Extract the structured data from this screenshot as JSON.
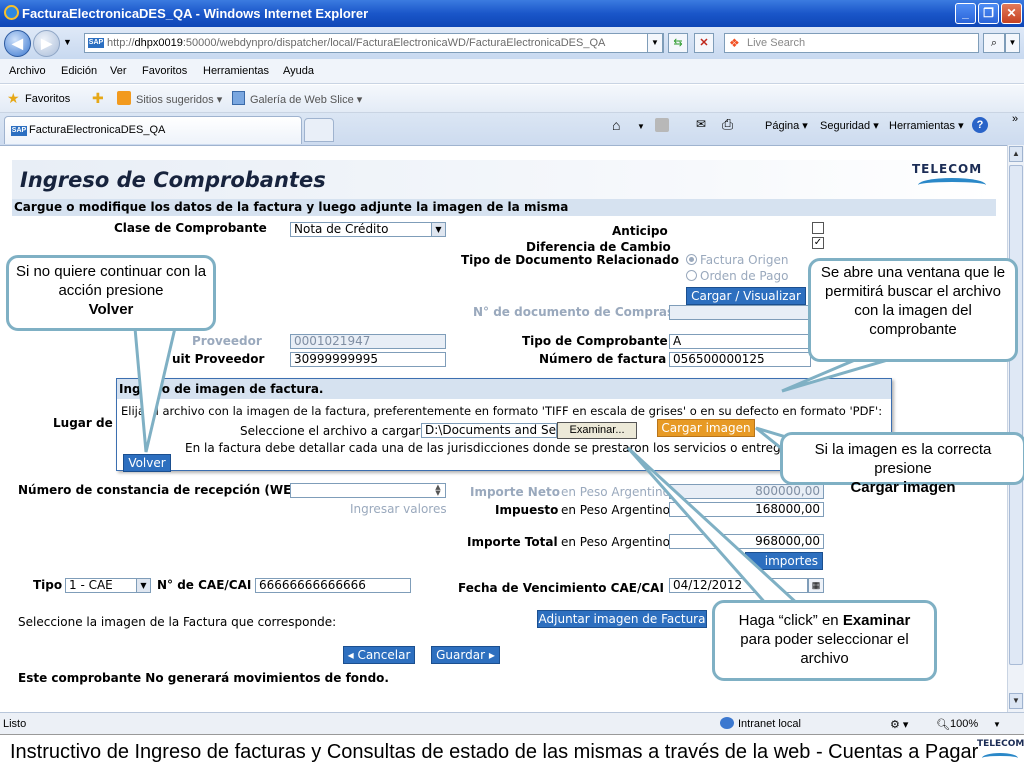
{
  "window": {
    "title": "FacturaElectronicaDES_QA - Windows Internet Explorer"
  },
  "address": {
    "url_prefix": "http://",
    "url_host": "dhpx0019",
    "url_rest": ":50000/webdynpro/dispatcher/local/FacturaElectronicaWD/FacturaElectronicaDES_QA",
    "search_placeholder": "Live Search"
  },
  "menu": [
    "Archivo",
    "Edición",
    "Ver",
    "Favoritos",
    "Herramientas",
    "Ayuda"
  ],
  "favorites": {
    "label": "Favoritos",
    "suggested": "Sitios sugeridos ▾",
    "gallery": "Galería de Web Slice ▾"
  },
  "tab": {
    "label": "FacturaElectronicaDES_QA"
  },
  "commandbar": {
    "page": "Página ▾",
    "security": "Seguridad ▾",
    "tools": "Herramientas ▾"
  },
  "page": {
    "title": "Ingreso de Comprobantes",
    "brand": "TELECOM",
    "subtitle": "Cargue o modifique los datos de la factura y luego adjunte la imagen de la misma",
    "clase_label": "Clase de Comprobante",
    "clase_value": "Nota de Crédito",
    "anticipo_label": "Anticipo",
    "dif_cambio_label": "Diferencia de Cambio",
    "tipo_doc_rel_label": "Tipo de Documento Relacionado",
    "radio_factura": "Factura Origen",
    "radio_orden": "Orden de Pago",
    "cargar_visualizar": "Cargar / Visualizar",
    "nro_doc_compras_label": "N° de documento de Compras",
    "proveedor_label": "Proveedor",
    "proveedor_value": "0001021947",
    "cuit_label": "uit Proveedor",
    "cuit_value": "30999999995",
    "tipo_comp_label": "Tipo de Comprobante",
    "tipo_comp_value": "A",
    "nro_factura_label": "Número de factura",
    "nro_factura_value": "056500000125",
    "lugar_label": "Lugar de",
    "constancia_label": "Número de constancia de recepción (WE)",
    "ingresar_valores": "Ingresar valores",
    "importe_neto_label": "Importe Neto",
    "importe_neto_currency": "en Peso Argentino",
    "importe_neto_value": "800000,00",
    "impuesto_label": "Impuesto",
    "impuesto_currency": "en Peso Argentino",
    "impuesto_value": "168000,00",
    "importe_total_label": "Importe Total",
    "importe_total_currency": "en Peso Argentino",
    "importe_total_value": "968000,00",
    "importes_btn": "importes",
    "tipo_label": "Tipo",
    "tipo_value": "1 - CAE",
    "nro_cae_label": "N° de CAE/CAI",
    "nro_cae_value": "66666666666666",
    "fecha_venc_label": "Fecha de Vencimiento CAE/CAI",
    "fecha_venc_value": "04/12/2012",
    "seleccione_imagen": "Seleccione la imagen de la Factura que corresponde:",
    "adjuntar_btn": "Adjuntar imagen de Factura",
    "cancelar_btn": "Cancelar",
    "guardar_btn": "Guardar",
    "footer_note": "Este comprobante No generará movimientos de fondo."
  },
  "popup": {
    "title": "Ingreso de imagen de factura.",
    "instructions": "Elija el archivo con la imagen de la factura, preferentemente en formato 'TIFF en escala de grises' o en su defecto en formato 'PDF':",
    "file_label": "Seleccione el archivo a cargar:",
    "file_value": "D:\\Documents and Set",
    "examinar": "Examinar...",
    "cargar_imagen": "Cargar imagen",
    "note": "En la factura debe detallar cada una de las jurisdicciones donde se prestaron los servicios o entrega de",
    "volver": "Volver"
  },
  "callouts": {
    "volver_pre": "Si no quiere continuar con la acción presione",
    "volver_bold": "Volver",
    "ventana": "Se abre una ventana que le permitirá buscar el archivo con la imagen del comprobante",
    "cargar_pre": "Si la imagen es la correcta presione",
    "cargar_bold": "Cargar  imagen",
    "examinar_pre": "Haga “click” en",
    "examinar_bold": "Examinar",
    "examinar_post": "para poder seleccionar el archivo"
  },
  "status": {
    "left": "Listo",
    "zone": "Intranet local",
    "zoom": "100%"
  },
  "footer": {
    "text": "Instructivo de Ingreso de facturas y Consultas de estado de las mismas a través de la web    -   Cuentas a Pagar",
    "logo": "TELECOM"
  }
}
